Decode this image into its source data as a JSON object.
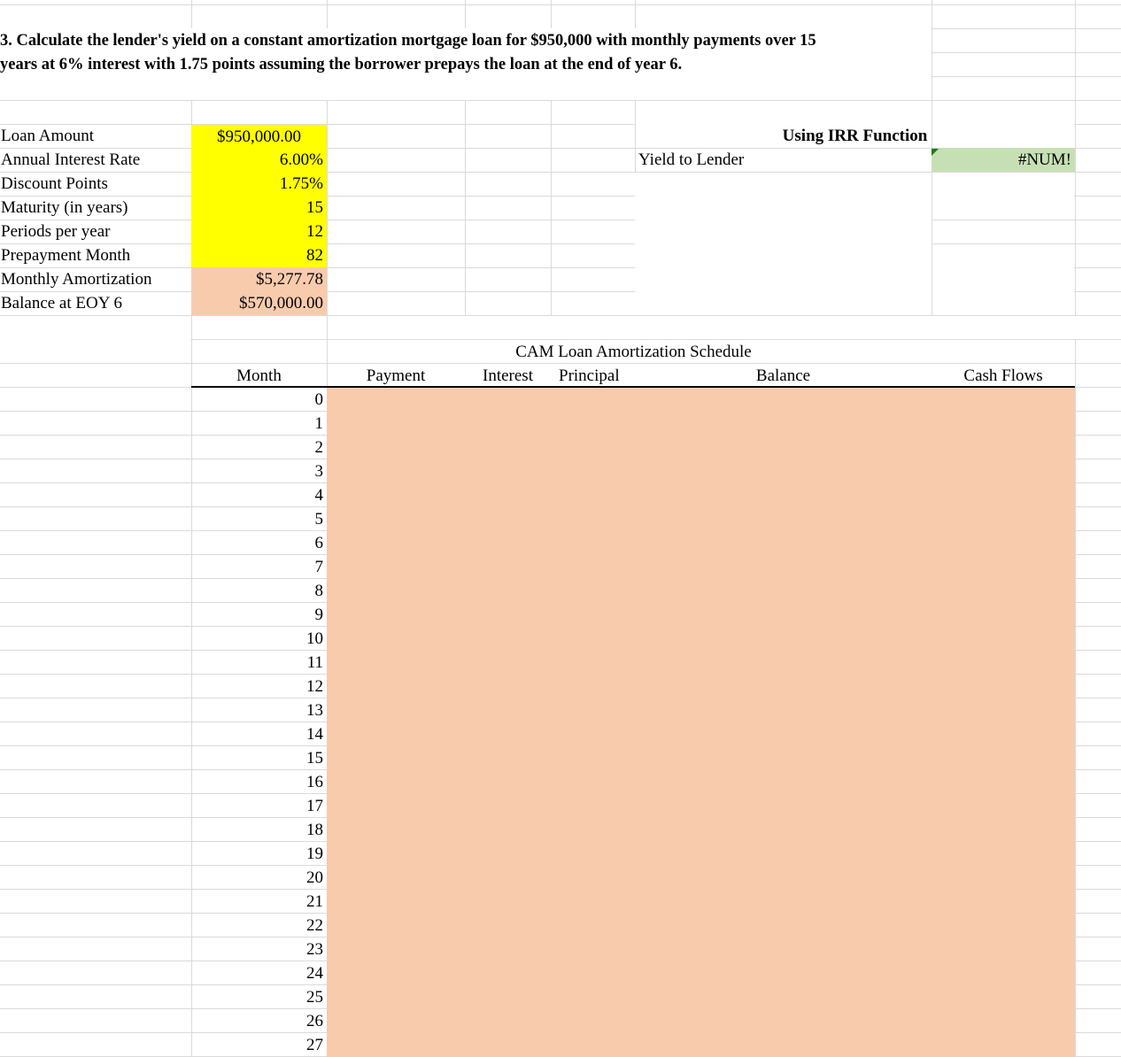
{
  "problem": {
    "line1": "3.  Calculate the lender's yield on a constant amortization mortgage loan for $950,000 with monthly payments over 15",
    "line2": "years at 6% interest with 1.75 points assuming the borrower prepays the loan at the end of year 6."
  },
  "inputs": [
    {
      "label": "Loan Amount",
      "value": "$950,000.00",
      "fill": "yellow"
    },
    {
      "label": "Annual Interest Rate",
      "value": "6.00%",
      "fill": "yellow"
    },
    {
      "label": "Discount Points",
      "value": "1.75%",
      "fill": "yellow"
    },
    {
      "label": "Maturity (in years)",
      "value": "15",
      "fill": "yellow"
    },
    {
      "label": "Periods per year",
      "value": "12",
      "fill": "yellow"
    },
    {
      "label": "Prepayment Month",
      "value": "82",
      "fill": "yellow"
    },
    {
      "label": "Monthly Amortization",
      "value": "$5,277.78",
      "fill": "salmon"
    },
    {
      "label": "Balance at EOY 6",
      "value": "$570,000.00",
      "fill": "salmon"
    }
  ],
  "irr": {
    "heading": "Using IRR Function",
    "label": "Yield to Lender",
    "value": "#NUM!"
  },
  "schedule": {
    "title": "CAM Loan Amortization Schedule",
    "headers": {
      "month": "Month",
      "payment": "Payment",
      "interest": "Interest",
      "principal": "Principal",
      "balance": "Balance",
      "cash_flows": "Cash Flows"
    },
    "months": [
      "0",
      "1",
      "2",
      "3",
      "4",
      "5",
      "6",
      "7",
      "8",
      "9",
      "10",
      "11",
      "12",
      "13",
      "14",
      "15",
      "16",
      "17",
      "18",
      "19",
      "20",
      "21",
      "22",
      "23",
      "24",
      "25",
      "26",
      "27"
    ]
  },
  "colors": {
    "input_fill": "#ffff00",
    "calc_fill": "#f8cbad",
    "result_fill": "#c6e0b4",
    "error_indicator": "#1e7b1e"
  }
}
